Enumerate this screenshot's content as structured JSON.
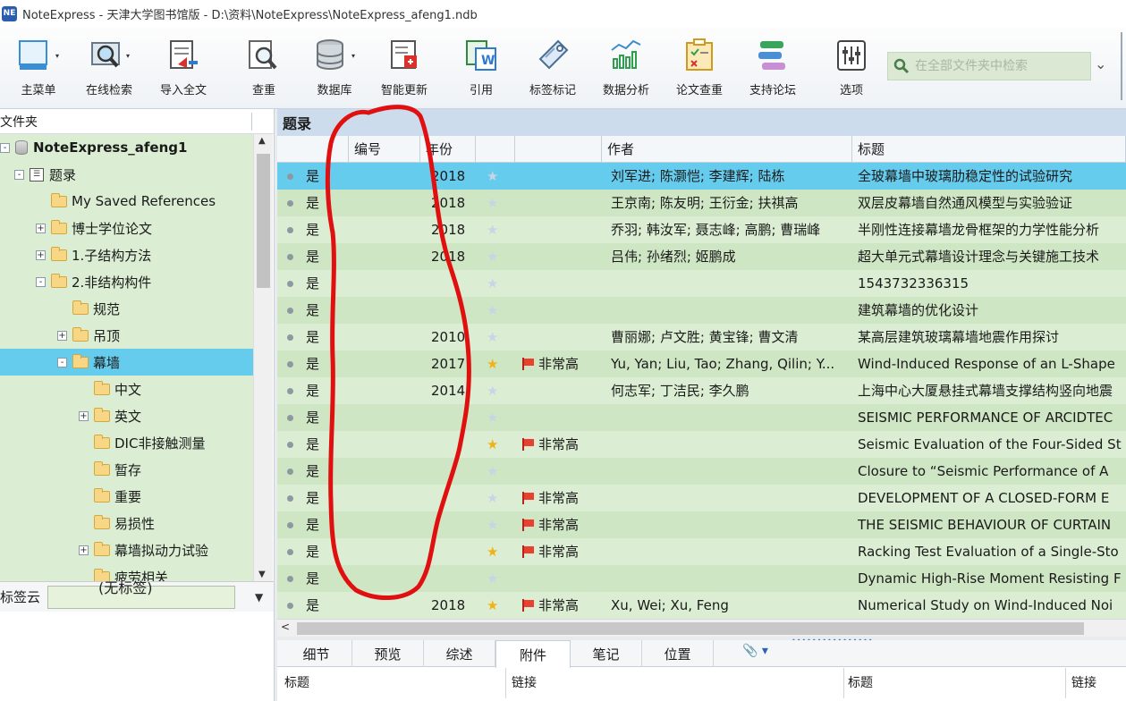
{
  "window": {
    "title": "NoteExpress - 天津大学图书馆版 - D:\\资料\\NoteExpress\\NoteExpress_afeng1.ndb",
    "app_icon_text": "NE"
  },
  "toolbar": {
    "buttons": [
      {
        "label": "主菜单",
        "icon": "main-menu-icon"
      },
      {
        "label": "在线检索",
        "icon": "online-search-icon"
      },
      {
        "label": "导入全文",
        "icon": "import-fulltext-icon"
      },
      {
        "label": "查重",
        "icon": "dedupe-icon"
      },
      {
        "label": "数据库",
        "icon": "database-icon"
      },
      {
        "label": "智能更新",
        "icon": "smart-update-icon"
      },
      {
        "label": "引用",
        "icon": "cite-icon"
      },
      {
        "label": "标签标记",
        "icon": "tag-icon"
      },
      {
        "label": "数据分析",
        "icon": "analytics-icon"
      },
      {
        "label": "论文查重",
        "icon": "paper-check-icon"
      },
      {
        "label": "支持论坛",
        "icon": "forum-icon"
      },
      {
        "label": "选项",
        "icon": "options-icon"
      }
    ],
    "search_placeholder": "在全部文件夹中检索"
  },
  "left_panel": {
    "header": "文件夹",
    "tree": [
      {
        "label": "NoteExpress_afeng1",
        "level": 0,
        "expander": "-",
        "icon": "database-icon",
        "bold": true
      },
      {
        "label": "题录",
        "level": 1,
        "expander": "-",
        "icon": "list-icon"
      },
      {
        "label": "My Saved References",
        "level": 2,
        "expander": "",
        "icon": "folder-icon"
      },
      {
        "label": "博士学位论文",
        "level": 2,
        "expander": "+",
        "icon": "folder-icon"
      },
      {
        "label": "1.子结构方法",
        "level": 2,
        "expander": "+",
        "icon": "folder-icon"
      },
      {
        "label": "2.非结构构件",
        "level": 2,
        "expander": "-",
        "icon": "folder-icon"
      },
      {
        "label": "规范",
        "level": 3,
        "expander": "",
        "icon": "folder-icon"
      },
      {
        "label": "吊顶",
        "level": 3,
        "expander": "+",
        "icon": "folder-icon"
      },
      {
        "label": "幕墙",
        "level": 3,
        "expander": "-",
        "icon": "folder-icon",
        "selected": true
      },
      {
        "label": "中文",
        "level": 4,
        "expander": "",
        "icon": "folder-icon"
      },
      {
        "label": "英文",
        "level": 4,
        "expander": "+",
        "icon": "folder-icon"
      },
      {
        "label": "DIC非接触测量",
        "level": 4,
        "expander": "",
        "icon": "folder-icon"
      },
      {
        "label": "暂存",
        "level": 4,
        "expander": "",
        "icon": "folder-icon"
      },
      {
        "label": "重要",
        "level": 4,
        "expander": "",
        "icon": "folder-icon"
      },
      {
        "label": "易损性",
        "level": 4,
        "expander": "",
        "icon": "folder-icon"
      },
      {
        "label": "幕墙拟动力试验",
        "level": 4,
        "expander": "+",
        "icon": "folder-icon"
      },
      {
        "label": "疲劳相关",
        "level": 4,
        "expander": "",
        "icon": "folder-icon"
      }
    ],
    "tags_label": "标签云",
    "no_tags": "(无标签)"
  },
  "main": {
    "title": "题录",
    "columns": [
      "",
      "编号",
      "年份",
      "",
      "",
      "作者",
      "标题"
    ],
    "rows": [
      {
        "read": "是",
        "number": "",
        "year": "2018",
        "starred": false,
        "flag": "",
        "authors": "刘军进; 陈灏恺; 李建辉; 陆栋",
        "title": "全玻幕墙中玻璃肋稳定性的试验研究",
        "selected": true
      },
      {
        "read": "是",
        "number": "",
        "year": "2018",
        "starred": false,
        "flag": "",
        "authors": "王京南; 陈友明; 王衍金; 扶祺高",
        "title": "双层皮幕墙自然通风模型与实验验证"
      },
      {
        "read": "是",
        "number": "",
        "year": "2018",
        "starred": false,
        "flag": "",
        "authors": "乔羽; 韩汝军; 聂志峰; 高鹏; 曹瑞峰",
        "title": "半刚性连接幕墙龙骨框架的力学性能分析"
      },
      {
        "read": "是",
        "number": "",
        "year": "2018",
        "starred": false,
        "flag": "",
        "authors": "吕伟; 孙绪烈; 姬鹏成",
        "title": "超大单元式幕墙设计理念与关键施工技术"
      },
      {
        "read": "是",
        "number": "",
        "year": "",
        "starred": false,
        "flag": "",
        "authors": "",
        "title": "1543732336315"
      },
      {
        "read": "是",
        "number": "",
        "year": "",
        "starred": false,
        "flag": "",
        "authors": "",
        "title": "建筑幕墙的优化设计"
      },
      {
        "read": "是",
        "number": "",
        "year": "2010",
        "starred": false,
        "flag": "",
        "authors": "曹丽娜; 卢文胜; 黄宝锋; 曹文清",
        "title": "某高层建筑玻璃幕墙地震作用探讨"
      },
      {
        "read": "是",
        "number": "",
        "year": "2017",
        "starred": true,
        "flag": "非常高",
        "authors": "Yu, Yan; Liu, Tao; Zhang, Qilin; Y...",
        "title": "Wind-Induced Response of an L-Shape"
      },
      {
        "read": "是",
        "number": "",
        "year": "2014",
        "starred": false,
        "flag": "",
        "authors": "何志军; 丁洁民; 李久鹏",
        "title": "上海中心大厦悬挂式幕墙支撑结构竖向地震"
      },
      {
        "read": "是",
        "number": "",
        "year": "",
        "starred": false,
        "flag": "",
        "authors": "",
        "title": "SEISMIC PERFORMANCE OF ARCIDTEC"
      },
      {
        "read": "是",
        "number": "",
        "year": "",
        "starred": true,
        "flag": "非常高",
        "authors": "",
        "title": "Seismic Evaluation of the Four-Sided St"
      },
      {
        "read": "是",
        "number": "",
        "year": "",
        "starred": false,
        "flag": "",
        "authors": "",
        "title": "Closure to “Seismic Performance of A"
      },
      {
        "read": "是",
        "number": "",
        "year": "",
        "starred": false,
        "flag": "非常高",
        "authors": "",
        "title": "DEVELOPMENT OF A CLOSED-FORM E"
      },
      {
        "read": "是",
        "number": "",
        "year": "",
        "starred": false,
        "flag": "非常高",
        "authors": "",
        "title": "THE SEISMIC BEHAVIOUR OF CURTAIN"
      },
      {
        "read": "是",
        "number": "",
        "year": "",
        "starred": true,
        "flag": "非常高",
        "authors": "",
        "title": "Racking Test Evaluation of a Single-Sto"
      },
      {
        "read": "是",
        "number": "",
        "year": "",
        "starred": false,
        "flag": "",
        "authors": "",
        "title": "Dynamic High-Rise Moment Resisting F"
      },
      {
        "read": "是",
        "number": "",
        "year": "2018",
        "starred": true,
        "flag": "非常高",
        "authors": "Xu, Wei; Xu, Feng",
        "title": "Numerical Study on Wind-Induced Noi"
      }
    ]
  },
  "bottom": {
    "tabs": [
      "细节",
      "预览",
      "综述",
      "附件",
      "笔记",
      "位置"
    ],
    "active_tab": "附件",
    "columns": [
      "标题",
      "链接",
      "标题",
      "链接"
    ]
  },
  "colors": {
    "selection": "#66ccee",
    "row_bg": "#dbeed3",
    "row_alt": "#cfe6c4",
    "header_bg": "#ccdcec",
    "annotation": "#e01010",
    "star_on": "#f1b215",
    "flag": "#e8412f"
  }
}
